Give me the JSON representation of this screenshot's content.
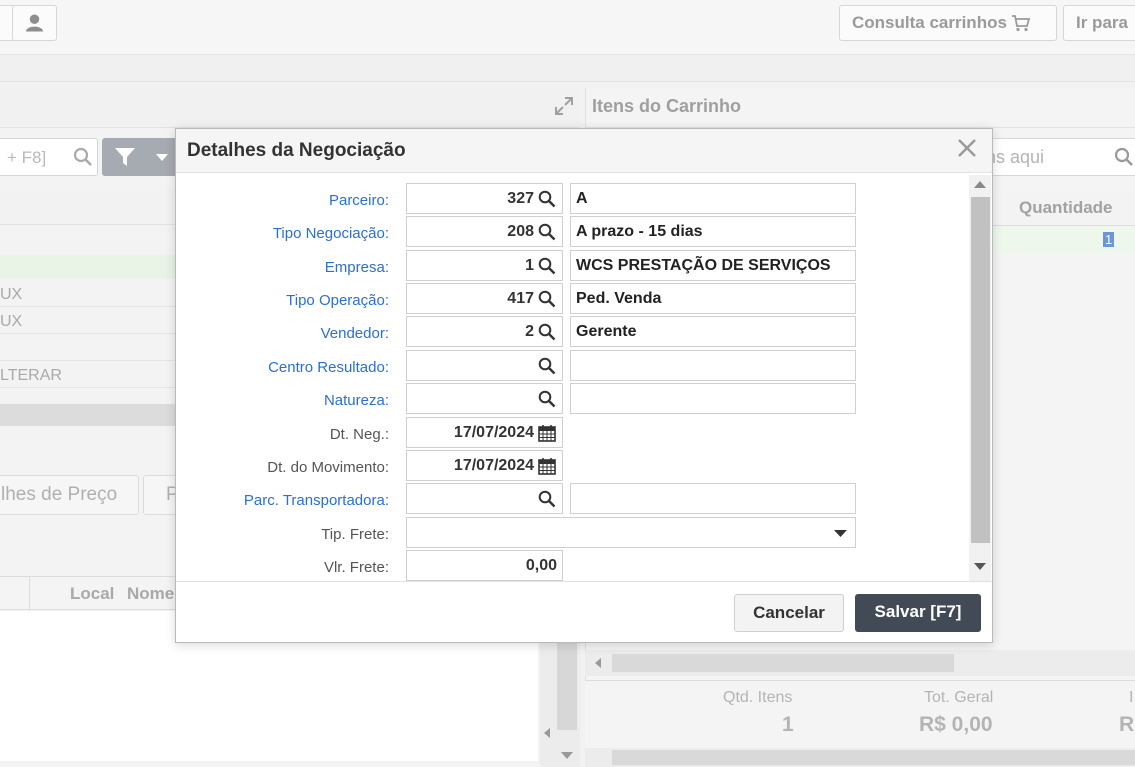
{
  "app": {
    "topbar": {
      "consulta_carrinhos": "Consulta carrinhos",
      "ir_para": "Ir para"
    },
    "left_panel": {
      "search_placeholder": "+ F8]",
      "rows": [
        "UX",
        "UX",
        "",
        "LTERAR"
      ],
      "tabs": [
        "lhes de Preço",
        "P"
      ],
      "grid_headers": [
        "Local",
        "Nome"
      ]
    },
    "cart_panel": {
      "title": "Itens do Carrinho",
      "search_placeholder": "ns aqui",
      "grid_header": "Quantidade",
      "first_qty": "1",
      "totals": {
        "qtd_itens_label": "Qtd. Itens",
        "qtd_itens_value": "1",
        "tot_geral_label": "Tot. Geral",
        "tot_geral_value": "R$ 0,00",
        "third_label": "I",
        "third_value": "R"
      }
    }
  },
  "modal": {
    "title": "Detalhes da Negociação",
    "fields": {
      "parceiro": {
        "label": "Parceiro:",
        "code": "327",
        "desc": "A"
      },
      "tipo_negociacao": {
        "label": "Tipo Negociação:",
        "code": "208",
        "desc": "A prazo - 15 dias"
      },
      "empresa": {
        "label": "Empresa:",
        "code": "1",
        "desc": "WCS PRESTAÇÃO DE SERVIÇOS"
      },
      "tipo_operacao": {
        "label": "Tipo Operação:",
        "code": "417",
        "desc": "Ped. Venda"
      },
      "vendedor": {
        "label": "Vendedor:",
        "code": "2",
        "desc": "Gerente"
      },
      "centro_resultado": {
        "label": "Centro Resultado:",
        "code": "",
        "desc": ""
      },
      "natureza": {
        "label": "Natureza:",
        "code": "",
        "desc": ""
      },
      "dt_neg": {
        "label": "Dt. Neg.:",
        "value": "17/07/2024"
      },
      "dt_movimento": {
        "label": "Dt. do Movimento:",
        "value": "17/07/2024"
      },
      "parc_transportadora": {
        "label": "Parc. Transportadora:",
        "code": "",
        "desc": ""
      },
      "tip_frete": {
        "label": "Tip. Frete:",
        "value": ""
      },
      "vlr_frete": {
        "label": "Vlr. Frete:",
        "value": "0,00"
      }
    },
    "buttons": {
      "cancel": "Cancelar",
      "save": "Salvar [F7]"
    }
  },
  "icons": {
    "search": "search-icon",
    "calendar": "calendar-icon",
    "close": "close-icon",
    "dropdown": "chevron-down-icon",
    "cart": "cart-icon",
    "user": "user-icon",
    "filter": "filter-icon",
    "expand": "expand-icon"
  },
  "colors": {
    "link_label": "#2a6fd6",
    "save_button": "#424b55",
    "selected_row": "#eef7ec"
  }
}
